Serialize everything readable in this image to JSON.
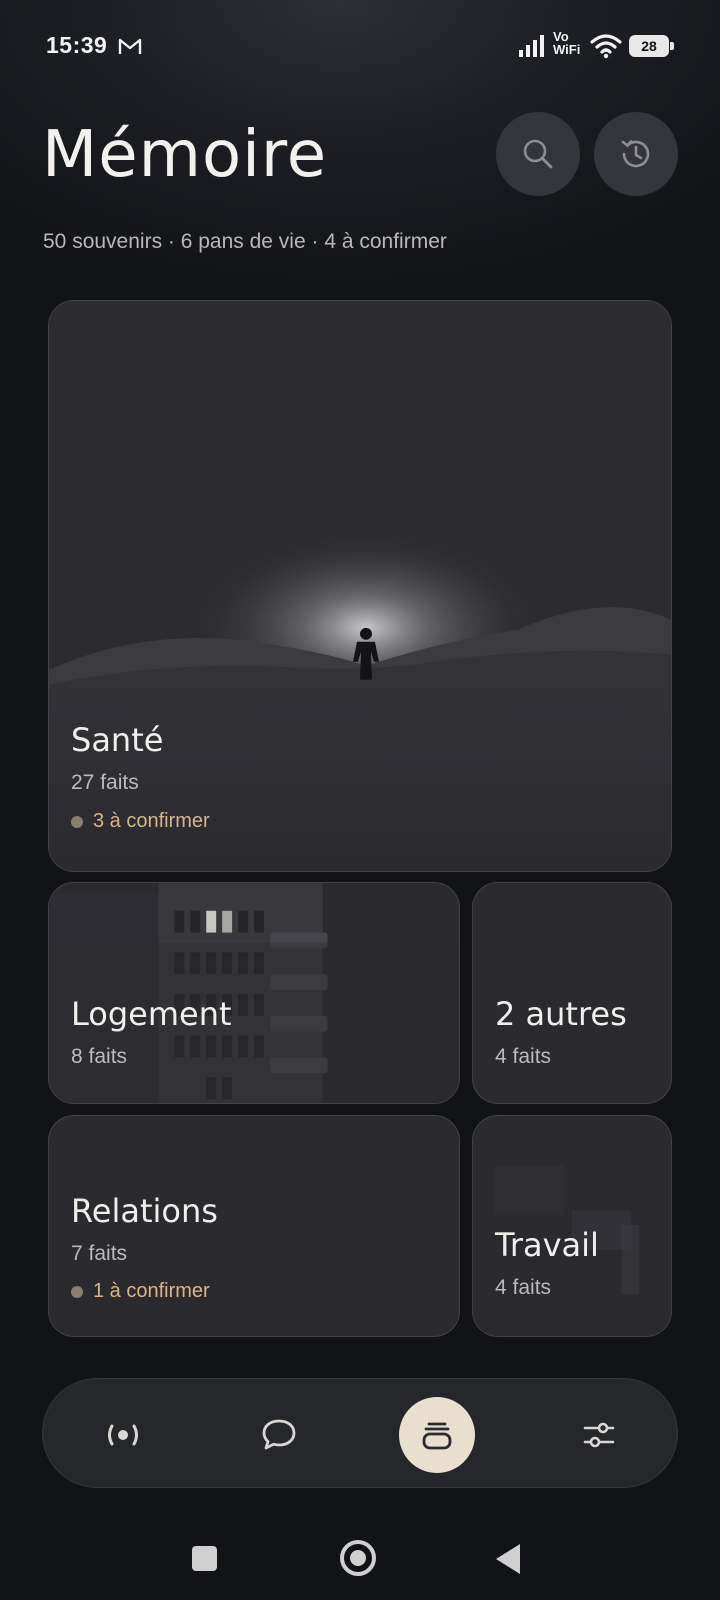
{
  "status_bar": {
    "time": "15:39",
    "vowifi_top": "Vo",
    "vowifi_bottom": "WiFi",
    "battery": "28",
    "icons": [
      "gmail-icon",
      "signal-icon",
      "wifi-icon",
      "battery-icon"
    ]
  },
  "header": {
    "title": "Mémoire",
    "subtitle": "50 souvenirs · 6 pans de vie · 4 à confirmer",
    "search_icon": "search-icon",
    "history_icon": "history-icon"
  },
  "cards": {
    "sante": {
      "title": "Santé",
      "count": "27 faits",
      "pending": "3 à confirmer"
    },
    "logement": {
      "title": "Logement",
      "count": "8 faits"
    },
    "autres": {
      "title": "2 autres",
      "count": "4 faits"
    },
    "relations": {
      "title": "Relations",
      "count": "7 faits",
      "pending": "1 à confirmer"
    },
    "travail": {
      "title": "Travail",
      "count": "4 faits"
    }
  },
  "bottom_nav": {
    "items": [
      {
        "icon": "live-icon",
        "active": false
      },
      {
        "icon": "chat-bubble-icon",
        "active": false
      },
      {
        "icon": "memory-stack-icon",
        "active": true
      },
      {
        "icon": "sliders-icon",
        "active": false
      }
    ],
    "active_color": "#e9dfcf"
  },
  "colors": {
    "background": "#121317",
    "card": "#2a2a2f",
    "pending_text": "#d6b58a"
  }
}
